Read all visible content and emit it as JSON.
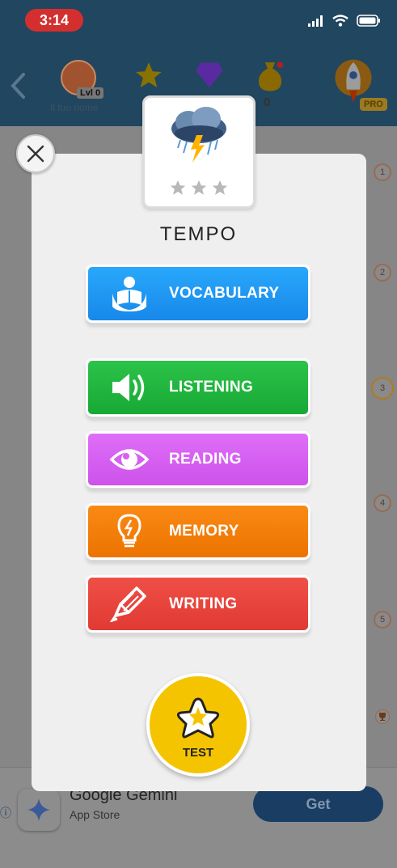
{
  "status": {
    "time": "3:14"
  },
  "header": {
    "level": "Lvl 0",
    "user_name": "Il tuo nome",
    "coins": "0",
    "pro": "PRO"
  },
  "timeline": [
    "1",
    "2",
    "3",
    "4",
    "5"
  ],
  "modal": {
    "title": "TEMPO",
    "stars_filled": 0,
    "stars_total": 3,
    "buttons": {
      "vocabulary": "VOCABULARY",
      "listening": "LISTENING",
      "reading": "READING",
      "memory": "MEMORY",
      "writing": "WRITING"
    },
    "test": "TEST",
    "colors": {
      "vocabulary": "#1d96f2",
      "listening": "#1fb73c",
      "reading": "#d65ef0",
      "memory": "#f37d0b",
      "writing": "#e8433b",
      "test": "#f5c400"
    }
  },
  "ad": {
    "title": "Google Gemini",
    "subtitle": "App Store",
    "cta": "Get"
  },
  "icons": {
    "card": "storm-cloud-icon",
    "vocabulary": "reader-icon",
    "listening": "speaker-icon",
    "reading": "eye-icon",
    "memory": "lightbulb-icon",
    "writing": "pencil-icon",
    "test": "star-icon"
  }
}
